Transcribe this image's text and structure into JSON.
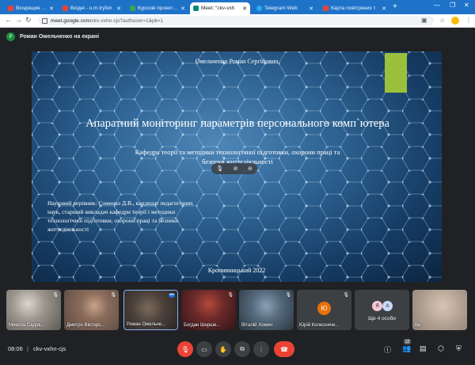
{
  "browser": {
    "tabs": [
      {
        "label": "Входящие - olmari",
        "favicon_color": "#ea4335"
      },
      {
        "label": "Вхідні - o.m.tryfon",
        "favicon_color": "#ea4335"
      },
      {
        "label": "Курсові проекти К",
        "favicon_color": "#34a853"
      },
      {
        "label": "Meet: \"ckv-vxh",
        "favicon_color": "#00897b"
      },
      {
        "label": "Telegram Web",
        "favicon_color": "#2aabee"
      },
      {
        "label": "Карта повітряних т",
        "favicon_color": "#ea4335"
      }
    ],
    "url_host": "meet.google.com",
    "url_path": "/ckv-vxhn-cjs?authuser=1&pli=1"
  },
  "meet": {
    "presenter_initial": "P",
    "presenter_label": "Роман Омельченко на екрані",
    "slide": {
      "author": "Омельченко Роман Сергійович",
      "title": "Апаратний моніторинг параметрів персонального комп`ютера",
      "dept": "Кафедра теорії та методики технологічної підготовки, охорони праці та безпеки життєдіяльності",
      "advisor": "Науковий керівник: Соменко Д.В., кандидат педагогічних наук, старший викладач кафедри теорії і методики технологічної підготовки, охорони праці та безпеки життєдіяльності",
      "city": "Кропивницький 2022",
      "accent_color": "#9bc13c"
    },
    "participants": [
      {
        "name": "Микола Садов..."
      },
      {
        "name": "Дмитро Вікторо..."
      },
      {
        "name": "Роман Омельче..."
      },
      {
        "name": "Богдан Шерше..."
      },
      {
        "name": "Віталій Хомич"
      },
      {
        "name": "Юрій Колесниче...",
        "initial": "Ю"
      },
      {
        "more_label": "Ще 4 особи",
        "initials": [
          "Я",
          "А"
        ]
      },
      {
        "name": "Ви"
      }
    ],
    "time": "08:06",
    "separator": "|",
    "meeting_code": "ckv-vxhn-cjs",
    "participant_count": "12"
  }
}
